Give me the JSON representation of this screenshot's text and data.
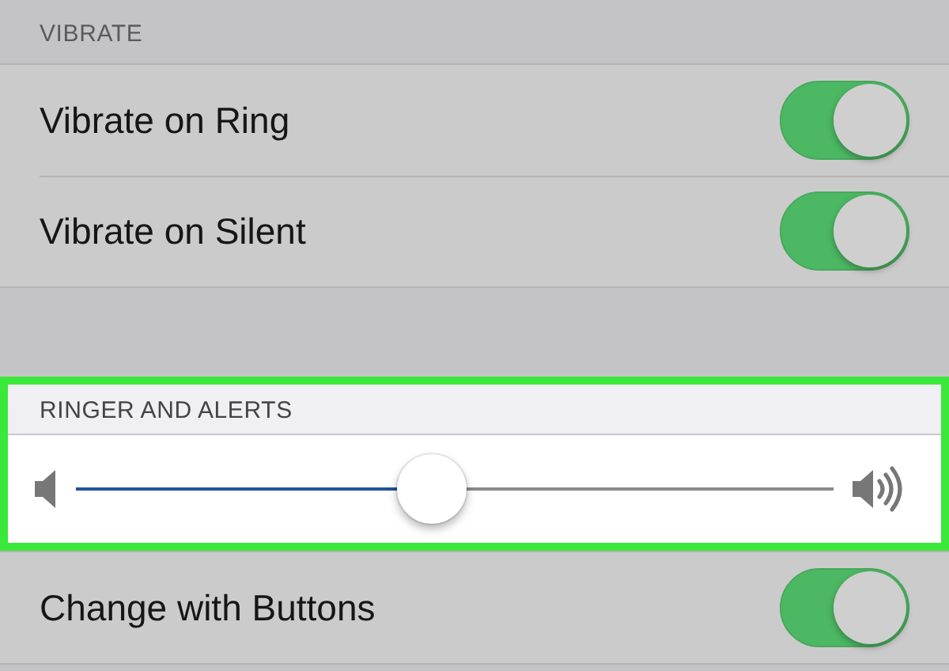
{
  "sections": [
    {
      "header": "VIBRATE",
      "highlighted": false,
      "rows": [
        {
          "kind": "toggle",
          "label": "Vibrate on Ring",
          "on": true
        },
        {
          "kind": "toggle",
          "label": "Vibrate on Silent",
          "on": true
        }
      ]
    },
    {
      "header": "RINGER AND ALERTS",
      "highlighted": true,
      "rows": [
        {
          "kind": "slider",
          "level": 0.47
        }
      ]
    },
    {
      "highlighted": false,
      "rows": [
        {
          "kind": "toggle",
          "label": "Change with Buttons",
          "on": true
        }
      ]
    }
  ]
}
